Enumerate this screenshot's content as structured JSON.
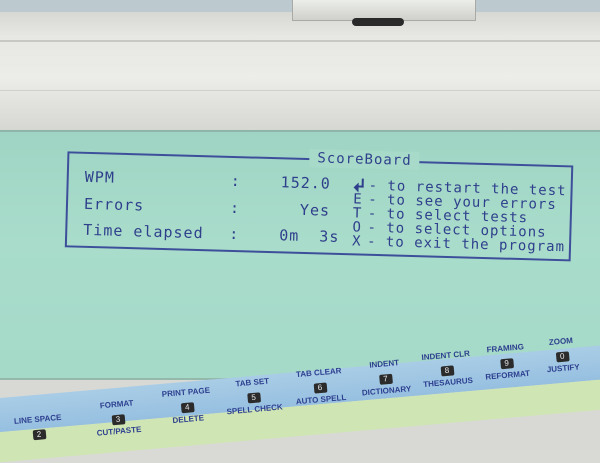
{
  "scoreboard": {
    "title": "ScoreBoard",
    "stats": [
      {
        "label": "WPM",
        "sep": ":",
        "value": "152.0"
      },
      {
        "label": "Errors",
        "sep": ":",
        "value": "Yes"
      },
      {
        "label": "Time elapsed",
        "sep": ":",
        "value": "0m  3s"
      }
    ],
    "options": [
      {
        "key_icon": "return-arrow-icon",
        "text": "- to restart the test"
      },
      {
        "key": "E",
        "text": "- to see your errors"
      },
      {
        "key": "T",
        "text": "- to select tests"
      },
      {
        "key": "O",
        "text": "- to select options"
      },
      {
        "key": "X",
        "text": "- to exit the program"
      }
    ]
  },
  "function_keys": [
    {
      "num": "2",
      "top": "LINE SPACE",
      "bottom": ""
    },
    {
      "num": "3",
      "top": "FORMAT",
      "bottom": "CUT/PASTE"
    },
    {
      "num": "4",
      "top": "PRINT PAGE",
      "bottom": "DELETE"
    },
    {
      "num": "5",
      "top": "TAB SET",
      "bottom": "SPELL CHECK"
    },
    {
      "num": "6",
      "top": "TAB CLEAR",
      "bottom": "AUTO SPELL"
    },
    {
      "num": "7",
      "top": "INDENT",
      "bottom": "DICTIONARY"
    },
    {
      "num": "8",
      "top": "INDENT CLR",
      "bottom": "THESAURUS"
    },
    {
      "num": "9",
      "top": "FRAMING",
      "bottom": "REFORMAT"
    },
    {
      "num": "0",
      "top": "ZOOM",
      "bottom": "JUSTIFY"
    }
  ],
  "colors": {
    "lcd_background": "#a7dac9",
    "lcd_text": "#2f3f8c",
    "key_strip_blue": "#9fc6e3",
    "key_strip_green": "#cfe6b4"
  }
}
